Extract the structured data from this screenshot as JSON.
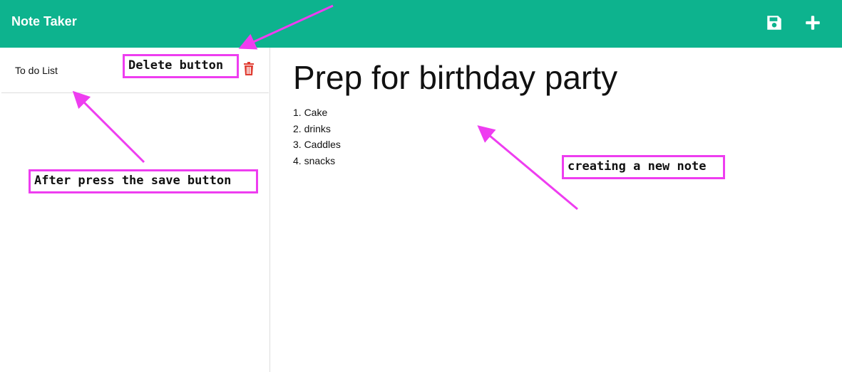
{
  "app": {
    "title": "Note Taker",
    "accent_color": "#0db38e"
  },
  "toolbar": {
    "save_icon": "save-icon",
    "new_icon": "plus-icon"
  },
  "sidebar": {
    "notes": [
      {
        "title": "To do List",
        "delete_icon": "trash-icon",
        "delete_color": "#e03c31"
      }
    ]
  },
  "editor": {
    "title": "Prep for birthday party",
    "body": "1. Cake\n2. drinks\n3. Caddles\n4. snacks"
  },
  "annotations": {
    "delete_label": "Delete button",
    "save_label": "After press the save button",
    "new_label": "creating a new note",
    "color": "#ee3df0"
  }
}
